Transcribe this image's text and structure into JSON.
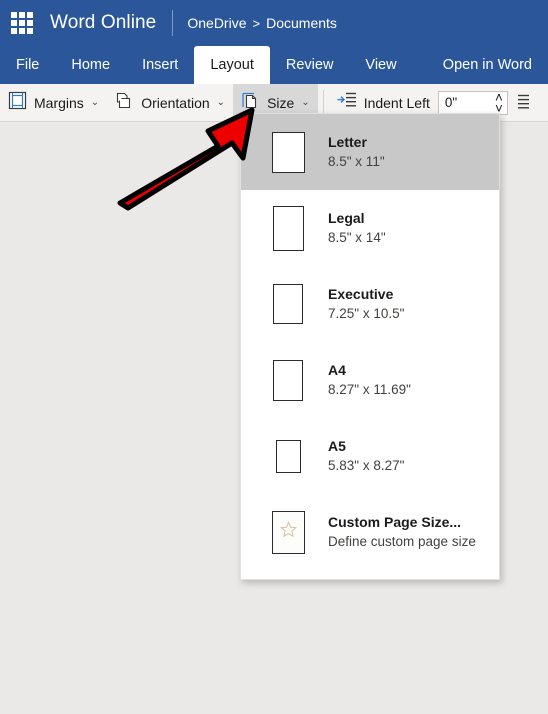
{
  "header": {
    "app_launcher_icon": "waffle-grid-icon",
    "app_title": "Word Online",
    "breadcrumb_root": "OneDrive",
    "breadcrumb_separator": ">",
    "breadcrumb_current": "Documents",
    "background_color": "#2b579a"
  },
  "tabs": [
    {
      "label": "File",
      "active": false
    },
    {
      "label": "Home",
      "active": false
    },
    {
      "label": "Insert",
      "active": false
    },
    {
      "label": "Layout",
      "active": true
    },
    {
      "label": "Review",
      "active": false
    },
    {
      "label": "View",
      "active": false
    },
    {
      "label": "Open in Word",
      "active": false
    }
  ],
  "ribbon": {
    "margins": {
      "label": "Margins",
      "icon": "margins-icon",
      "caret": "⌄"
    },
    "orientation": {
      "label": "Orientation",
      "icon": "orientation-icon",
      "caret": "⌄"
    },
    "size": {
      "label": "Size",
      "icon": "page-size-icon",
      "caret": "⌄",
      "highlighted": true
    },
    "indent_left": {
      "label": "Indent Left",
      "icon": "indent-left-icon",
      "value": "0\"",
      "up_arrow": "˄",
      "down_arrow": "˅"
    },
    "end_icon": "indent-right-icon",
    "background_color": "#f4f3f2"
  },
  "dropdown": {
    "name": "page-size-menu",
    "selected_index": 0,
    "items": [
      {
        "name": "Letter",
        "dimensions": "8.5\" x 11\"",
        "selected": true,
        "thumb_w": 33,
        "thumb_h": 41
      },
      {
        "name": "Legal",
        "dimensions": "8.5\" x 14\"",
        "selected": false,
        "thumb_w": 31,
        "thumb_h": 45
      },
      {
        "name": "Executive",
        "dimensions": "7.25\" x 10.5\"",
        "selected": false,
        "thumb_w": 30,
        "thumb_h": 40
      },
      {
        "name": "A4",
        "dimensions": "8.27\" x 11.69\"",
        "selected": false,
        "thumb_w": 30,
        "thumb_h": 41
      },
      {
        "name": "A5",
        "dimensions": "5.83\" x 8.27\"",
        "selected": false,
        "thumb_w": 25,
        "thumb_h": 33
      },
      {
        "name": "Custom Page Size...",
        "dimensions": "Define custom page size",
        "selected": false,
        "icon": "star-icon"
      }
    ]
  },
  "annotation": {
    "arrow_color": "#ee0000",
    "arrow_outline_color": "#000000",
    "name": "red-arrow-pointer"
  },
  "page": {
    "background_color": "#eae9e7"
  }
}
